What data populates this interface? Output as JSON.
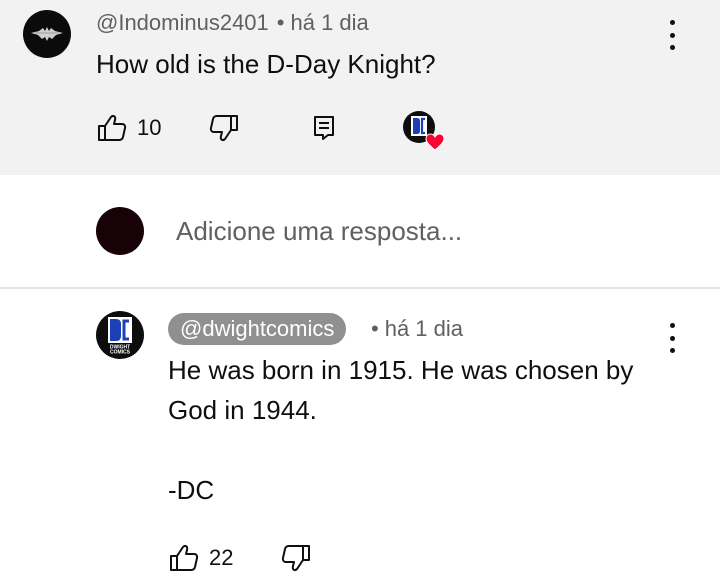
{
  "top_comment": {
    "author": "@Indominus2401",
    "separator": "•",
    "time": "há 1 dia",
    "text": "How old is the D-Day Knight?",
    "like_count": "10",
    "avatar_icon": "bat-symbol-icon",
    "hearted": true,
    "heart_color": "#ff0033"
  },
  "reply_box": {
    "placeholder": "Adicione uma resposta..."
  },
  "reply": {
    "author": "@dwightcomics",
    "separator": "•",
    "time": "há 1 dia",
    "text_lines": [
      "He was born in 1915. He was chosen by",
      "God in 1944.",
      "",
      "-DC"
    ],
    "like_count": "22",
    "avatar_logo_text": "DC",
    "avatar_caption_lines": [
      "DWIGHT",
      "COMICS"
    ]
  },
  "colors": {
    "top_bg": "#f2f2f2",
    "meta_text": "#606060",
    "chip_bg": "#909090",
    "divider": "#e5e5e5"
  }
}
